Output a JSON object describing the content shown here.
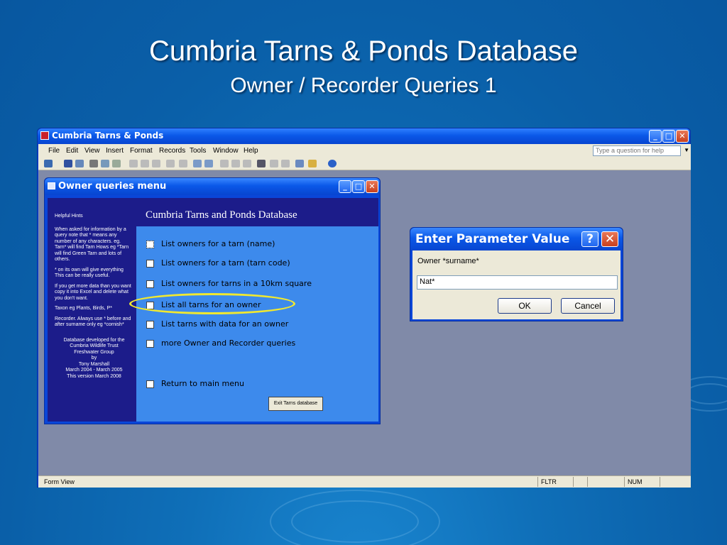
{
  "slide": {
    "title": "Cumbria Tarns & Ponds Database",
    "subtitle": "Owner / Recorder Queries 1"
  },
  "app_window": {
    "title": "Cumbria Tarns & Ponds",
    "menu": [
      "File",
      "Edit",
      "View",
      "Insert",
      "Format",
      "Records",
      "Tools",
      "Window",
      "Help"
    ],
    "help_placeholder": "Type a question for help",
    "status_left": "Form View",
    "status_cells": [
      "FLTR",
      "NUM"
    ]
  },
  "form": {
    "title": "Owner queries menu",
    "heading": "Cumbria Tarns and Ponds Database",
    "hints": [
      "Helpful Hints",
      "When asked for information by a query note that * means any number of any characters. eg. Tarn* will find Tarn Hows eg *Tarn will find Green Tarn and lots of others.",
      "* on its own will give everything This can be really useful.",
      "If you get more data than you want copy it into Excel and delete what you don't want.",
      "Taxon eg Plants, Birds, P*",
      "Recorder. Always use * before and after surname only eg *cornish*"
    ],
    "credits": [
      "Database developed for the",
      "Cumbria Wildlife Trust",
      "Freshwater Group",
      "by",
      "Tony Marshall",
      "March 2004 - March 2005",
      "This version March 2008"
    ],
    "options": [
      "List owners for a tarn (name)",
      "List owners for a tarn (tarn code)",
      "List owners for tarns in a 10km square",
      "List all tarns for an owner",
      "List tarns with data for an owner",
      "more Owner and Recorder queries",
      "Return to main menu"
    ],
    "exit_label": "Exit Tarns database"
  },
  "dialog": {
    "title": "Enter Parameter Value",
    "help_glyph": "?",
    "close_glyph": "✕",
    "prompt": "Owner *surname*",
    "value": "Nat*",
    "ok_label": "OK",
    "cancel_label": "Cancel"
  }
}
